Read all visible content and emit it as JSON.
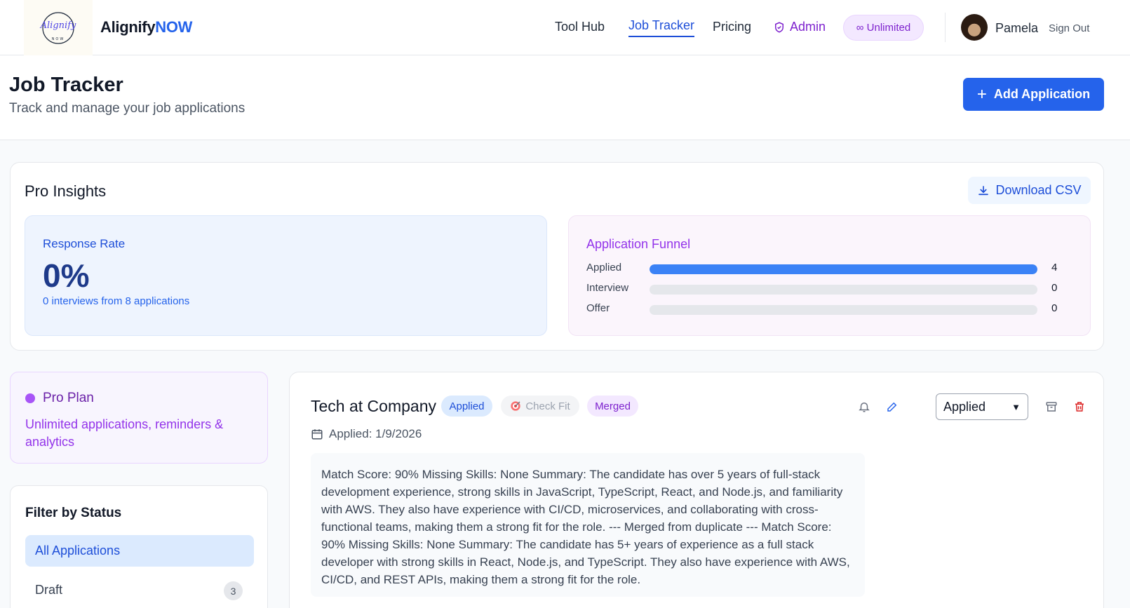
{
  "nav": {
    "brand_main": "Alignify",
    "brand_accent": "NOW",
    "logo_text": "Alignify",
    "logo_subtext": "NOW",
    "links": [
      "Tool Hub",
      "Job Tracker",
      "Pricing",
      "Admin"
    ],
    "active_link": "Job Tracker",
    "plan_pill": "∞ Unlimited",
    "user_name": "Pamela",
    "sign_out": "Sign Out"
  },
  "header": {
    "title": "Job Tracker",
    "subtitle": "Track and manage your job applications",
    "add_button": "Add Application"
  },
  "insights": {
    "title": "Pro Insights",
    "download_button": "Download CSV",
    "response_rate": {
      "label": "Response Rate",
      "value": "0%",
      "note": "0 interviews from 8 applications"
    },
    "funnel": {
      "title": "Application Funnel",
      "rows": [
        {
          "label": "Applied",
          "count": "4",
          "fill_fraction": 1.0
        },
        {
          "label": "Interview",
          "count": "0",
          "fill_fraction": 0.0
        },
        {
          "label": "Offer",
          "count": "0",
          "fill_fraction": 0.0
        }
      ]
    }
  },
  "plan": {
    "title": "Pro Plan",
    "description": "Unlimited applications, reminders & analytics"
  },
  "filter": {
    "title": "Filter by Status",
    "items": [
      {
        "label": "All Applications",
        "count": "",
        "active": true
      },
      {
        "label": "Draft",
        "count": "3",
        "active": false
      }
    ]
  },
  "application": {
    "title": "Tech at Company",
    "status_badge": "Applied",
    "check_fit": "Check Fit",
    "merged_badge": "Merged",
    "applied_date": "Applied: 1/9/2026",
    "status_select": "Applied",
    "notes": "Match Score: 90% Missing Skills: None Summary: The candidate has over 5 years of full-stack development experience, strong skills in JavaScript, TypeScript, React, and Node.js, and familiarity with AWS. They also have experience with CI/CD, microservices, and collaborating with cross-functional teams, making them a strong fit for the role. --- Merged from duplicate --- Match Score: 90% Missing Skills: None Summary: The candidate has 5+ years of experience as a full stack developer with strong skills in React, Node.js, and TypeScript. They also have experience with AWS, CI/CD, and REST APIs, making them a strong fit for the role."
  },
  "colors": {
    "primary": "#2563eb",
    "purple": "#9333ea",
    "danger": "#dc2626"
  }
}
